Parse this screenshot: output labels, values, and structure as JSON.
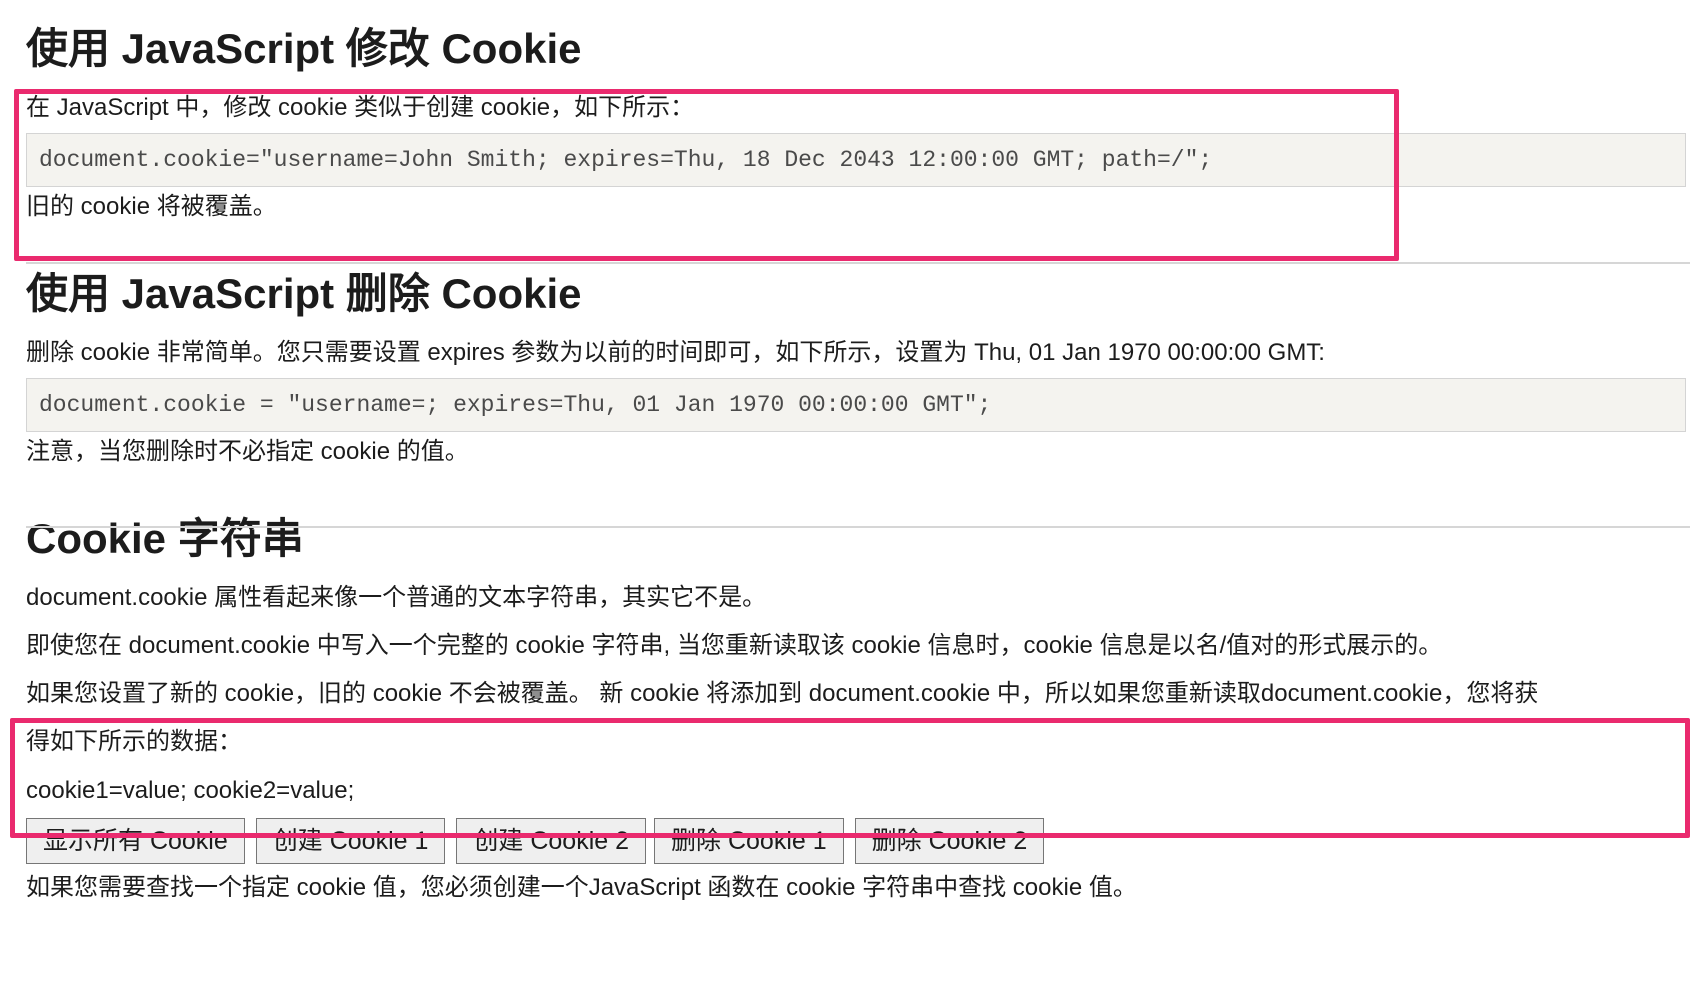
{
  "sections": {
    "modify": {
      "title": "使用 JavaScript 修改 Cookie",
      "intro": "在 JavaScript 中，修改 cookie 类似于创建 cookie，如下所示：",
      "code": "document.cookie=\"username=John Smith; expires=Thu, 18 Dec 2043 12:00:00 GMT; path=/\";",
      "note": "旧的 cookie 将被覆盖。"
    },
    "delete": {
      "title": "使用 JavaScript 删除 Cookie",
      "intro": "删除 cookie 非常简单。您只需要设置 expires 参数为以前的时间即可，如下所示，设置为 Thu, 01 Jan 1970 00:00:00 GMT:",
      "code": "document.cookie = \"username=; expires=Thu, 01 Jan 1970 00:00:00 GMT\";",
      "note": "注意，当您删除时不必指定 cookie 的值。"
    },
    "string": {
      "title": "Cookie 字符串",
      "p1": "document.cookie 属性看起来像一个普通的文本字符串，其实它不是。",
      "p2": "即使您在 document.cookie 中写入一个完整的 cookie 字符串, 当您重新读取该 cookie 信息时，cookie 信息是以名/值对的形式展示的。",
      "p3_line1": "如果您设置了新的 cookie，旧的 cookie 不会被覆盖。 新 cookie 将添加到 document.cookie 中，所以如果您重新读取document.cookie，您将获",
      "p3_line2": "得如下所示的数据：",
      "example": "cookie1=value; cookie2=value;",
      "buttons": [
        "显示所有 Cookie",
        "创建 Cookie 1",
        "创建 Cookie 2",
        "删除 Cookie 1",
        "删除 Cookie 2"
      ],
      "p4": "如果您需要查找一个指定 cookie 值，您必须创建一个JavaScript 函数在 cookie 字符串中查找 cookie 值。"
    }
  },
  "colors": {
    "highlight_border": "#ea2a6e",
    "code_background": "#f4f3ef",
    "divider": "#d6d6d6"
  }
}
